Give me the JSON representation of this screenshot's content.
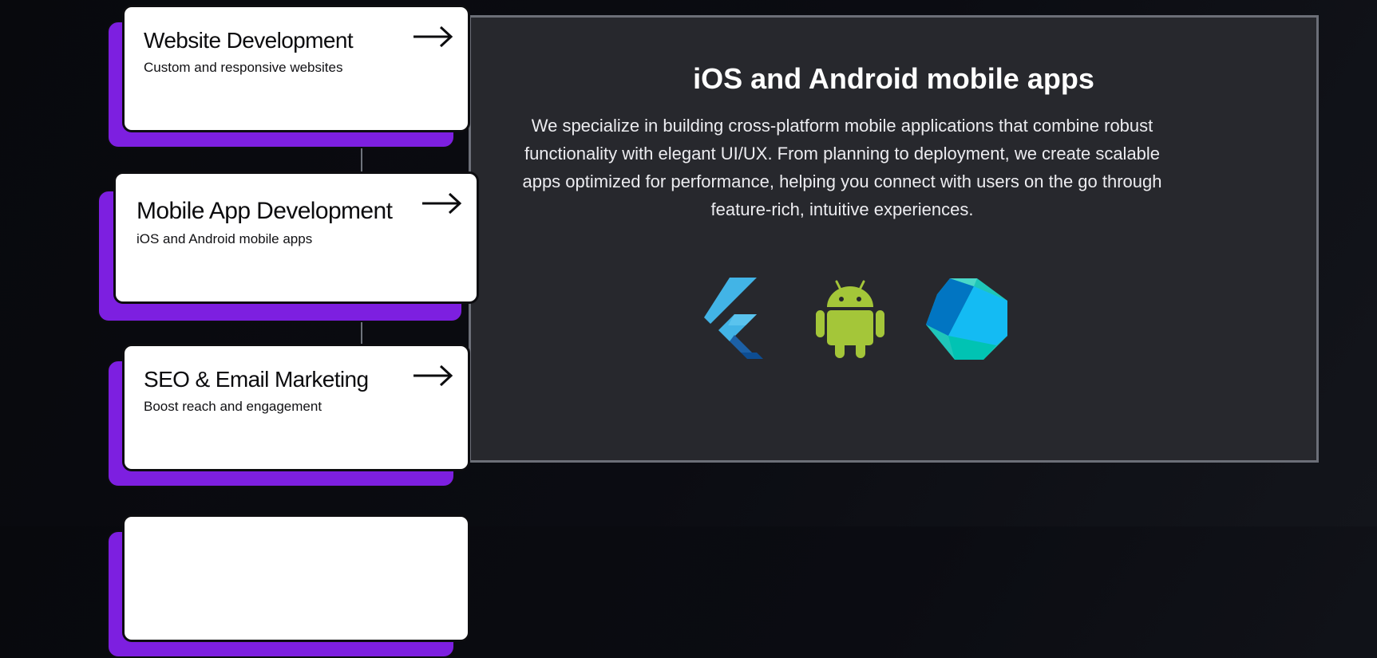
{
  "services": [
    {
      "title": "Website Development",
      "subtitle": "Custom and responsive websites",
      "arrow_icon": "arrow-right-icon"
    },
    {
      "title": "Mobile App Development",
      "subtitle": "iOS and Android mobile apps",
      "arrow_icon": "arrow-right-icon"
    },
    {
      "title": "SEO & Email Marketing",
      "subtitle": "Boost reach and engagement",
      "arrow_icon": "arrow-right-icon"
    },
    {
      "title": "",
      "subtitle": ""
    }
  ],
  "selected_service": 1,
  "detail": {
    "title": "iOS and Android mobile apps",
    "description": "We specialize in building cross-platform mobile applications that combine robust functionality with elegant UI/UX. From planning to deployment, we create scalable apps optimized for performance, helping you connect with users on the go through feature-rich, intuitive experiences.",
    "tech_logos": [
      "flutter-logo-icon",
      "android-logo-icon",
      "dart-logo-icon"
    ]
  },
  "colors": {
    "accent_purple": "#7d1fe0",
    "panel_bg": "#27282d",
    "panel_border": "#6c6f78",
    "page_bg": "#0a0b10",
    "card_bg": "#ffffff",
    "flutter_blue": "#42b4e6",
    "android_green": "#a4c639",
    "dart_teal": "#1fc6b9"
  }
}
